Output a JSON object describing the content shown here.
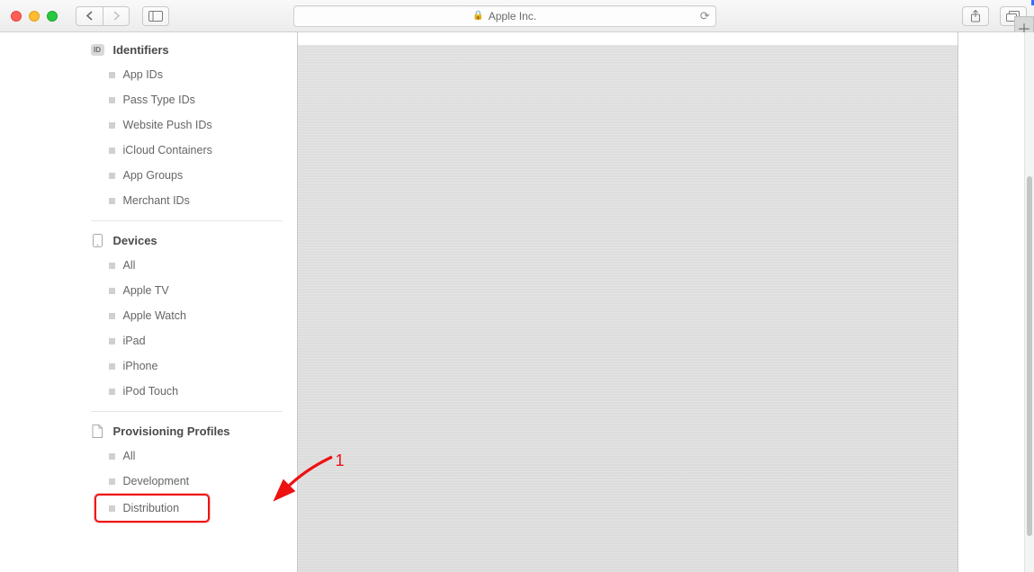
{
  "toolbar": {
    "site_label": "Apple Inc."
  },
  "annotation": {
    "label": "1"
  },
  "sidebar": {
    "identifiers": {
      "title": "Identifiers",
      "items": [
        "App IDs",
        "Pass Type IDs",
        "Website Push IDs",
        "iCloud Containers",
        "App Groups",
        "Merchant IDs"
      ]
    },
    "devices": {
      "title": "Devices",
      "items": [
        "All",
        "Apple TV",
        "Apple Watch",
        "iPad",
        "iPhone",
        "iPod Touch"
      ]
    },
    "profiles": {
      "title": "Provisioning Profiles",
      "items": [
        "All",
        "Development",
        "Distribution"
      ]
    }
  }
}
